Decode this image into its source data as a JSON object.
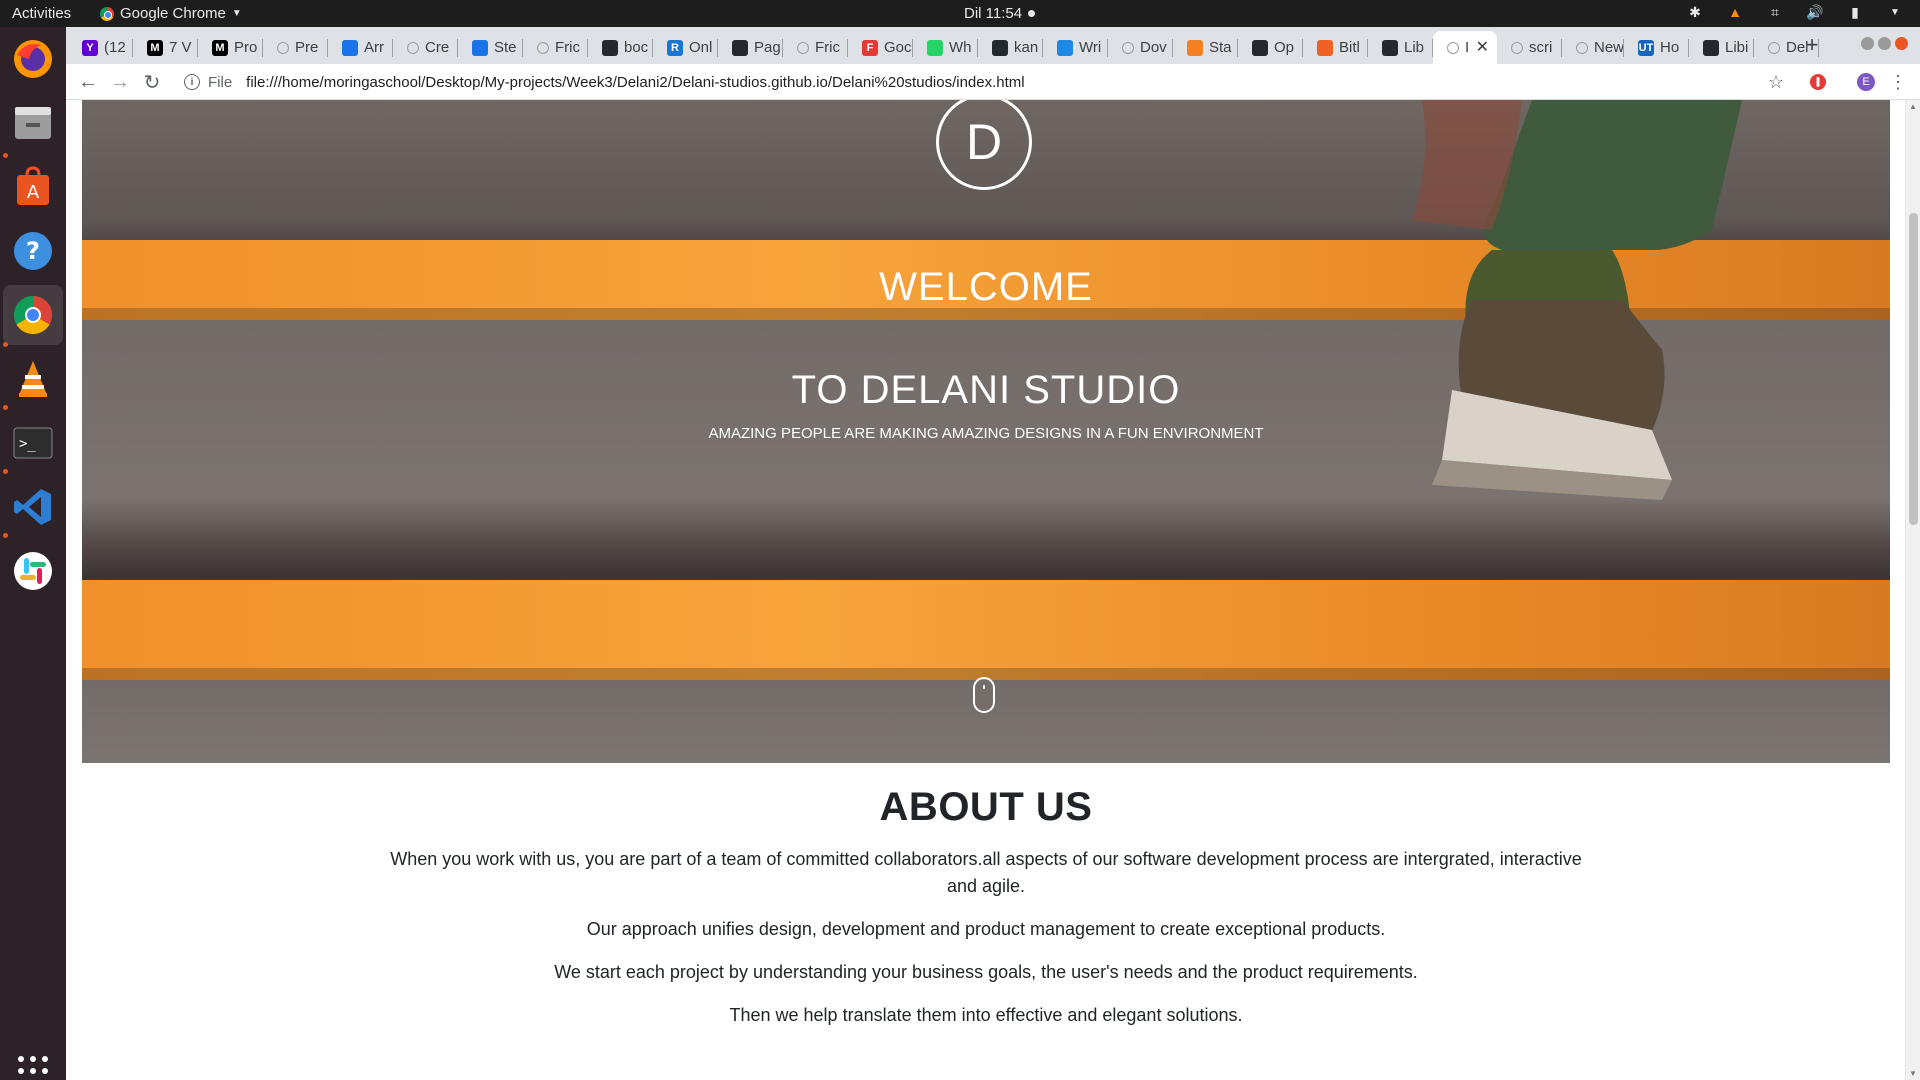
{
  "topbar": {
    "activities": "Activities",
    "app_name": "Google Chrome",
    "clock": "Dil 11:54"
  },
  "dock": {
    "apps": [
      "firefox-icon",
      "files-icon",
      "software-center-icon",
      "help-icon",
      "chrome-icon",
      "vlc-icon",
      "terminal-icon",
      "vscode-icon",
      "slack-icon",
      "show-apps-icon"
    ]
  },
  "tabs": [
    {
      "label": "(12",
      "fav": "Y",
      "color": "#6001d2"
    },
    {
      "label": "7 V",
      "fav": "M",
      "color": "#000000"
    },
    {
      "label": "Pro",
      "fav": "M",
      "color": "#000000"
    },
    {
      "label": "Pre",
      "fav": "",
      "color": "#dee1e6"
    },
    {
      "label": "Arr",
      "fav": "",
      "color": "#1a73e8"
    },
    {
      "label": "Cre",
      "fav": "",
      "color": "#dee1e6"
    },
    {
      "label": "Ste",
      "fav": "",
      "color": "#1a73e8"
    },
    {
      "label": "Fric",
      "fav": "",
      "color": "#dee1e6"
    },
    {
      "label": "boc",
      "fav": "",
      "color": "#24292e"
    },
    {
      "label": "Onl",
      "fav": "R",
      "color": "#1976d2"
    },
    {
      "label": "Pag",
      "fav": "",
      "color": "#24292e"
    },
    {
      "label": "Fric",
      "fav": "",
      "color": "#dee1e6"
    },
    {
      "label": "Goc",
      "fav": "F",
      "color": "#e53935"
    },
    {
      "label": "Wh",
      "fav": "",
      "color": "#25d366"
    },
    {
      "label": "kan",
      "fav": "",
      "color": "#24292e"
    },
    {
      "label": "Wri",
      "fav": "",
      "color": "#1e88e5"
    },
    {
      "label": "Dov",
      "fav": "",
      "color": "#dee1e6"
    },
    {
      "label": "Sta",
      "fav": "",
      "color": "#f48024"
    },
    {
      "label": "Op",
      "fav": "",
      "color": "#24292e"
    },
    {
      "label": "Bitl",
      "fav": "",
      "color": "#ee6123"
    },
    {
      "label": "Lib",
      "fav": "",
      "color": "#24292e"
    },
    {
      "label": "I",
      "fav": "",
      "color": "#dee1e6"
    },
    {
      "label": "scri",
      "fav": "",
      "color": "#dee1e6"
    },
    {
      "label": "New Ta",
      "fav": "",
      "color": "#dee1e6"
    },
    {
      "label": "Ho",
      "fav": "UT",
      "color": "#1565c0"
    },
    {
      "label": "Libi",
      "fav": "",
      "color": "#24292e"
    },
    {
      "label": "Del",
      "fav": "",
      "color": "#dee1e6"
    }
  ],
  "toolbar": {
    "scheme": "File",
    "url": "file:///home/moringaschool/Desktop/My-projects/Week3/Delani2/Delani-studios.github.io/Delani%20studios/index.html",
    "profile_initial": "E"
  },
  "hero": {
    "logo_letter": "D",
    "welcome": "WELCOME",
    "title": "TO DELANI STUDIO",
    "subtitle": "AMAZING PEOPLE ARE MAKING AMAZING DESIGNS IN A FUN ENVIRONMENT"
  },
  "about": {
    "heading": "ABOUT US",
    "paragraphs": [
      "When you work with us, you are part of a team of committed collaborators.all aspects of our software development process are intergrated, interactive and agile.",
      "Our approach unifies design, development and product management to create exceptional products.",
      "We start each project by understanding your business goals, the user's needs and the product requirements.",
      "Then we help translate them into effective and elegant solutions."
    ]
  },
  "colors": {
    "accent_orange": "#e95420",
    "stripe_orange": "#f7a43b"
  }
}
